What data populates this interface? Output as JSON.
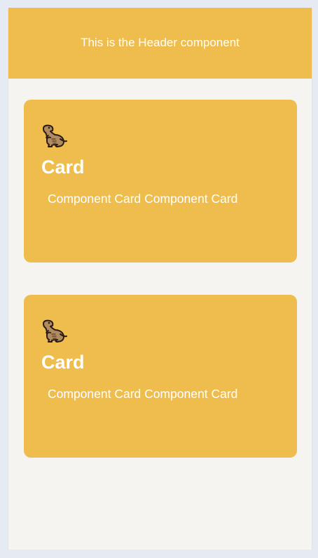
{
  "header": {
    "text": "This is the Header component"
  },
  "cards": [
    {
      "icon": "dinosaur-icon",
      "title": "Card",
      "body": "Component Card Component Card"
    },
    {
      "icon": "dinosaur-icon",
      "title": "Card",
      "body": "Component Card Component Card"
    }
  ],
  "colors": {
    "page_background": "#e6ebf3",
    "frame_background": "#f6f4f0",
    "accent": "#eebd4d",
    "text": "#ffffff"
  }
}
